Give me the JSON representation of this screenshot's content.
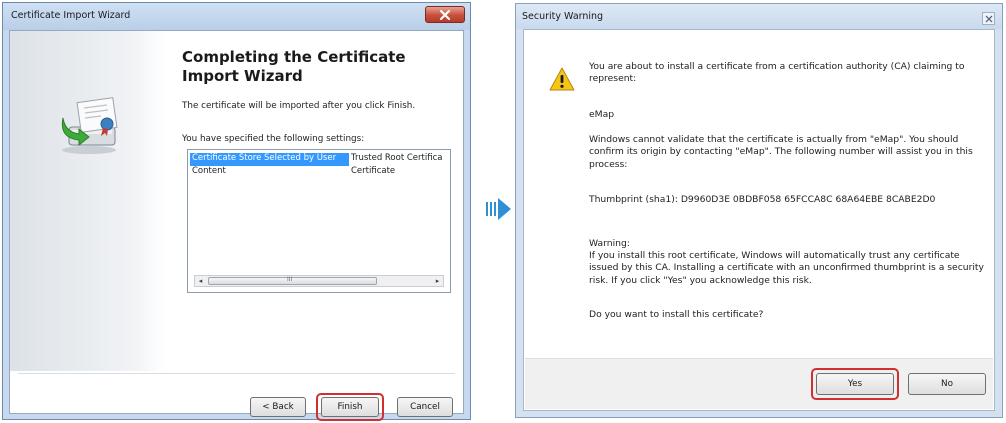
{
  "wizard": {
    "title": "Certificate Import Wizard",
    "heading": "Completing the Certificate Import Wizard",
    "description": "The certificate will be imported after you click Finish.",
    "settings_label": "You have specified the following settings:",
    "settings_rows": [
      {
        "setting": "Certificate Store Selected by User",
        "value": "Trusted Root Certifica"
      },
      {
        "setting": "Content",
        "value": "Certificate"
      }
    ],
    "scrollbar_grip": "III",
    "buttons": {
      "back": "< Back",
      "finish": "Finish",
      "cancel": "Cancel"
    },
    "icons": [
      "close-icon",
      "certificate-import-icon",
      "scroll-left-icon",
      "scroll-right-icon"
    ]
  },
  "security_warning": {
    "title": "Security Warning",
    "intro": "You are about to install a certificate from a certification authority (CA) claiming to represent:",
    "ca_name": "eMap",
    "validation_note": "Windows cannot validate that the certificate is actually from \"eMap\". You should confirm its origin by contacting \"eMap\". The following number will assist you in this process:",
    "thumbprint_label": "Thumbprint (sha1):",
    "thumbprint_value": "D9960D3E 0BDBF058 65FCCA8C 68A64EBE 8CABE2D0",
    "warning_label": "Warning:",
    "warning_text": "If you install this root certificate, Windows will automatically trust any certificate issued by this CA. Installing a certificate with an unconfirmed thumbprint is a security risk. If you click \"Yes\" you acknowledge this risk.",
    "question": "Do you want to install this certificate?",
    "buttons": {
      "yes": "Yes",
      "no": "No"
    },
    "icons": [
      "close-icon",
      "warning-icon"
    ]
  },
  "flow_arrow_icon": "right-arrow-icon",
  "colors": {
    "selection": "#3399ff",
    "highlight_ring": "#d03030",
    "flow_arrow": "#2e8fd4",
    "wizard_close": "#c7503c"
  }
}
